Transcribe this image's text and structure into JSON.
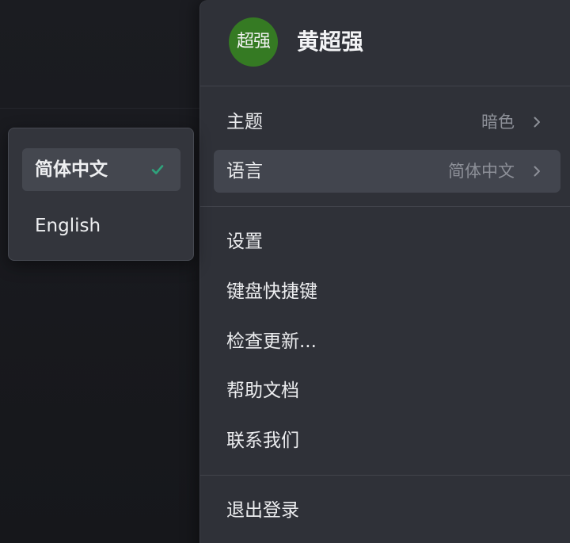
{
  "user": {
    "avatar_text": "超强",
    "avatar_color": "#357a23",
    "name": "黄超强"
  },
  "menu": {
    "theme": {
      "label": "主题",
      "value": "暗色"
    },
    "language": {
      "label": "语言",
      "value": "简体中文"
    },
    "settings_label": "设置",
    "shortcuts_label": "键盘快捷键",
    "check_updates_label": "检查更新...",
    "help_label": "帮助文档",
    "contact_label": "联系我们",
    "logout_label": "退出登录"
  },
  "language_submenu": {
    "options": [
      {
        "label": "简体中文",
        "selected": true
      },
      {
        "label": "English",
        "selected": false
      }
    ],
    "check_color": "#2fa37c"
  }
}
